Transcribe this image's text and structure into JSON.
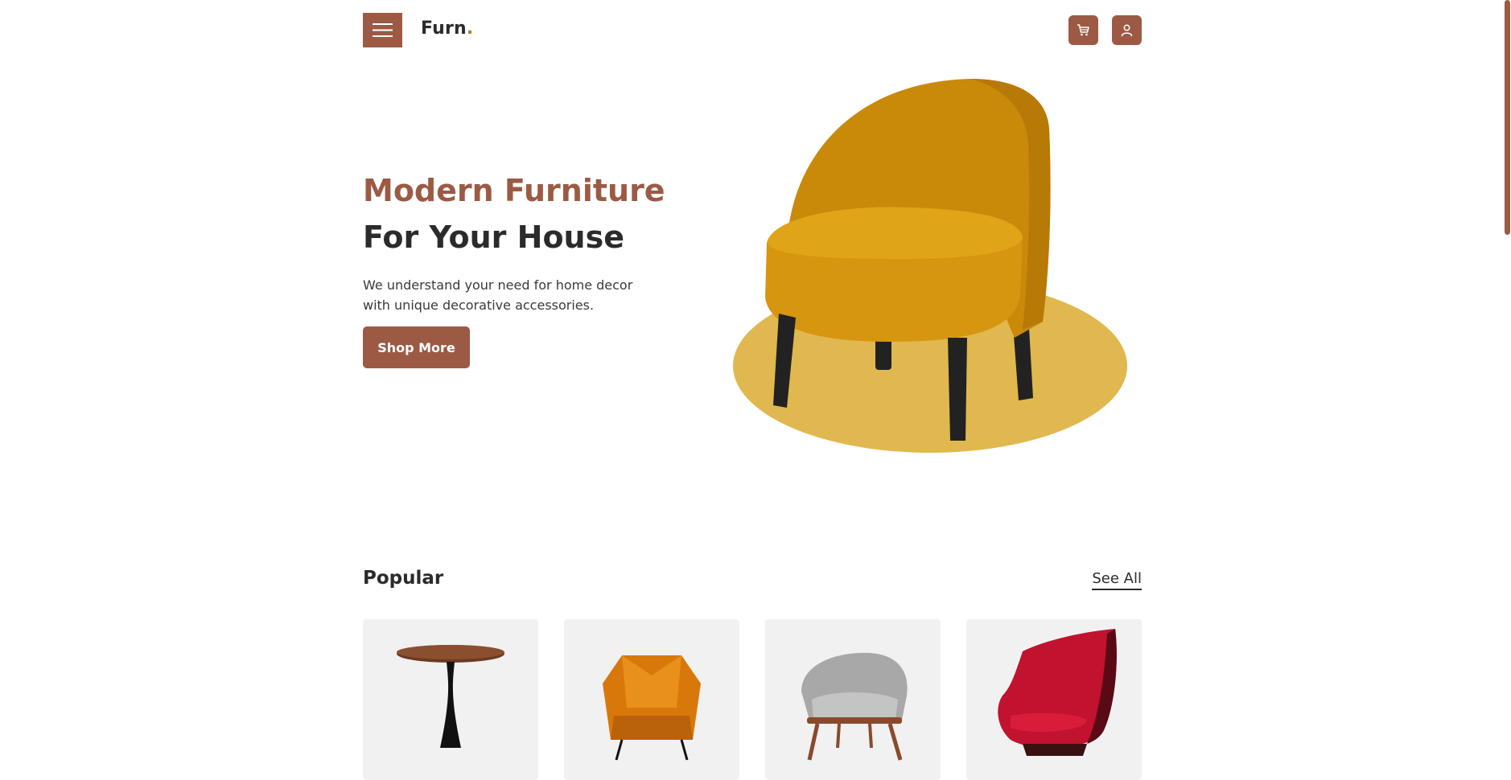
{
  "header": {
    "brand_name": "Furn",
    "brand_dot": ".",
    "menu_icon": "hamburger-icon",
    "cart_icon": "cart-icon",
    "user_icon": "user-icon"
  },
  "hero": {
    "title_accent": "Modern Furniture",
    "title_main": "For Your House",
    "description": "We understand your need for home decor with unique decorative accessories.",
    "cta_label": "Shop More"
  },
  "popular": {
    "title": "Popular",
    "see_all_label": "See All",
    "products": [
      {
        "icon": "round-table-image"
      },
      {
        "icon": "orange-armchair-image"
      },
      {
        "icon": "grey-lounge-chair-image"
      },
      {
        "icon": "red-egg-chair-image"
      }
    ]
  },
  "colors": {
    "accent": "#9c5a44",
    "text_dark": "#2b2b2b",
    "chair_yellow": "#c98a0a",
    "ellipse_gold": "#e0b84f",
    "card_bg": "#f1f1f1"
  }
}
